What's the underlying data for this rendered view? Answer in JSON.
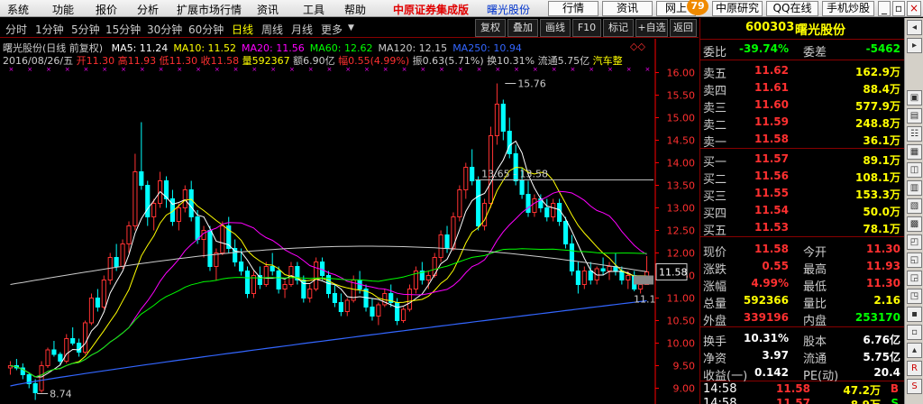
{
  "menu": {
    "items": [
      "系统",
      "功能",
      "报价",
      "分析",
      "扩展市场行情",
      "资讯",
      "工具",
      "帮助"
    ],
    "brand": "中原证券集成版",
    "brand_stock": "曙光股份",
    "right_buttons": [
      "行情",
      "资讯",
      "网上"
    ],
    "badge": "79",
    "right_buttons2": [
      "中原研究",
      "QQ在线",
      "手机炒股"
    ]
  },
  "toolbar": {
    "periods": [
      "分时",
      "1分钟",
      "5分钟",
      "15分钟",
      "30分钟",
      "60分钟",
      "日线",
      "周线",
      "月线",
      "更多"
    ],
    "active_period": "日线",
    "buttons": [
      "复权",
      "叠加",
      "画线",
      "F10",
      "标记",
      "+自选",
      "返回"
    ]
  },
  "chart_header": {
    "stock": "曙光股份(日线 前复权)",
    "ma": [
      {
        "label": "MA5: 11.24",
        "color": "#ffffff"
      },
      {
        "label": "MA10: 11.52",
        "color": "#ffff00"
      },
      {
        "label": "MA20: 11.56",
        "color": "#ff00ff"
      },
      {
        "label": "MA60: 12.62",
        "color": "#00ff00"
      },
      {
        "label": "MA120: 12.15",
        "color": "#cccccc"
      },
      {
        "label": "MA250: 10.94",
        "color": "#3366ff"
      }
    ],
    "info": {
      "date": "2016/08/26/五",
      "open": "开11.30",
      "high": "高11.93",
      "low": "低11.30",
      "close": "收11.58",
      "volume": "量592367",
      "amount": "额6.90亿",
      "change": "幅0.55(4.99%)",
      "amplitude": "振0.63(5.71%)",
      "turnover": "换10.31%",
      "float": "流通5.75亿",
      "sector": "汽车整"
    }
  },
  "chart_data": {
    "type": "candlestick",
    "y_ticks": [
      "16.00",
      "15.50",
      "15.00",
      "14.50",
      "14.00",
      "13.50",
      "13.00",
      "12.50",
      "12.00",
      "11.50",
      "11.00",
      "10.50",
      "10.00",
      "9.50",
      "9.00"
    ],
    "ylim": [
      8.75,
      16.15
    ],
    "annotations": [
      "15.76",
      "8.74",
      "13.65 - 13.58",
      "11.1"
    ],
    "current_price_label": "11.58",
    "candles": [
      [
        9.45,
        9.6,
        9.3,
        9.5
      ],
      [
        9.5,
        9.65,
        9.4,
        9.45
      ],
      [
        9.45,
        9.55,
        9.2,
        9.3
      ],
      [
        9.3,
        9.35,
        9.0,
        9.1
      ],
      [
        9.1,
        9.2,
        8.74,
        8.9
      ],
      [
        8.95,
        9.6,
        8.9,
        9.5
      ],
      [
        9.5,
        9.9,
        9.45,
        9.85
      ],
      [
        9.85,
        10.05,
        9.7,
        9.75
      ],
      [
        9.75,
        9.8,
        9.5,
        9.6
      ],
      [
        9.6,
        10.2,
        9.55,
        10.1
      ],
      [
        10.1,
        10.35,
        9.95,
        10.0
      ],
      [
        10.0,
        10.1,
        9.7,
        9.8
      ],
      [
        9.8,
        10.5,
        9.75,
        10.45
      ],
      [
        10.45,
        11.1,
        10.4,
        11.0
      ],
      [
        11.0,
        11.2,
        10.7,
        10.8
      ],
      [
        10.8,
        11.5,
        10.75,
        11.4
      ],
      [
        11.4,
        12.0,
        11.3,
        11.9
      ],
      [
        11.9,
        12.2,
        11.6,
        11.7
      ],
      [
        11.7,
        12.3,
        11.65,
        12.2
      ],
      [
        12.2,
        12.7,
        12.0,
        12.6
      ],
      [
        12.6,
        14.2,
        12.5,
        13.8
      ],
      [
        13.8,
        14.9,
        13.4,
        13.5
      ],
      [
        13.5,
        13.6,
        12.6,
        12.8
      ],
      [
        12.8,
        13.2,
        12.5,
        13.1
      ],
      [
        13.1,
        13.8,
        13.0,
        13.6
      ],
      [
        13.6,
        13.7,
        13.0,
        13.2
      ],
      [
        13.2,
        13.4,
        12.6,
        12.7
      ],
      [
        12.7,
        13.1,
        12.5,
        13.0
      ],
      [
        13.0,
        13.5,
        12.9,
        13.4
      ],
      [
        13.4,
        13.6,
        12.7,
        12.8
      ],
      [
        12.8,
        12.95,
        12.2,
        12.3
      ],
      [
        12.3,
        12.6,
        11.9,
        12.5
      ],
      [
        12.5,
        12.6,
        11.6,
        11.7
      ],
      [
        11.7,
        12.1,
        11.4,
        12.0
      ],
      [
        12.0,
        12.7,
        11.95,
        12.6
      ],
      [
        12.6,
        12.8,
        12.0,
        12.1
      ],
      [
        12.1,
        12.3,
        11.7,
        11.8
      ],
      [
        11.8,
        12.1,
        11.5,
        11.6
      ],
      [
        11.6,
        11.7,
        11.0,
        11.1
      ],
      [
        11.1,
        11.6,
        11.0,
        11.5
      ],
      [
        11.5,
        11.7,
        11.2,
        11.3
      ],
      [
        11.3,
        11.8,
        11.25,
        11.7
      ],
      [
        11.7,
        12.0,
        11.5,
        11.6
      ],
      [
        11.6,
        11.7,
        11.1,
        11.2
      ],
      [
        11.2,
        11.4,
        11.0,
        11.3
      ],
      [
        11.3,
        11.8,
        11.25,
        11.7
      ],
      [
        11.7,
        11.8,
        11.3,
        11.4
      ],
      [
        11.4,
        11.5,
        10.9,
        11.0
      ],
      [
        11.0,
        11.3,
        10.9,
        11.2
      ],
      [
        11.2,
        11.9,
        11.15,
        11.8
      ],
      [
        11.8,
        11.9,
        11.4,
        11.5
      ],
      [
        11.5,
        11.6,
        11.0,
        11.1
      ],
      [
        11.1,
        11.3,
        10.8,
        10.9
      ],
      [
        10.9,
        11.1,
        10.6,
        10.7
      ],
      [
        10.7,
        11.0,
        10.6,
        10.95
      ],
      [
        10.95,
        11.5,
        10.9,
        11.4
      ],
      [
        11.4,
        11.6,
        11.1,
        11.2
      ],
      [
        11.2,
        11.3,
        10.7,
        10.8
      ],
      [
        10.8,
        11.0,
        10.5,
        10.6
      ],
      [
        10.6,
        10.9,
        10.4,
        10.85
      ],
      [
        10.85,
        11.2,
        10.8,
        11.1
      ],
      [
        11.1,
        11.3,
        10.8,
        10.9
      ],
      [
        10.9,
        11.0,
        10.4,
        10.5
      ],
      [
        10.5,
        10.8,
        10.45,
        10.75
      ],
      [
        10.75,
        11.3,
        10.7,
        11.2
      ],
      [
        11.2,
        11.7,
        11.1,
        11.6
      ],
      [
        11.6,
        11.8,
        11.3,
        11.4
      ],
      [
        11.4,
        11.6,
        11.2,
        11.5
      ],
      [
        11.5,
        12.0,
        11.45,
        11.9
      ],
      [
        11.9,
        12.5,
        11.8,
        12.4
      ],
      [
        12.4,
        12.6,
        12.0,
        12.1
      ],
      [
        12.1,
        12.9,
        12.05,
        12.8
      ],
      [
        12.8,
        13.5,
        12.7,
        13.4
      ],
      [
        13.4,
        14.0,
        13.2,
        13.9
      ],
      [
        13.9,
        14.3,
        13.5,
        13.6
      ],
      [
        13.6,
        13.7,
        12.5,
        12.6
      ],
      [
        12.6,
        13.2,
        12.5,
        13.1
      ],
      [
        13.1,
        14.8,
        13.0,
        14.6
      ],
      [
        14.6,
        15.76,
        14.4,
        15.3
      ],
      [
        15.3,
        15.4,
        14.5,
        14.7
      ],
      [
        14.7,
        15.0,
        14.1,
        14.2
      ],
      [
        14.2,
        14.4,
        13.5,
        13.6
      ],
      [
        13.6,
        13.9,
        13.2,
        13.3
      ],
      [
        13.3,
        13.6,
        12.8,
        12.9
      ],
      [
        12.9,
        13.3,
        12.8,
        13.2
      ],
      [
        13.2,
        13.3,
        12.9,
        13.0
      ],
      [
        13.0,
        13.2,
        12.7,
        12.8
      ],
      [
        12.8,
        13.2,
        12.7,
        13.1
      ],
      [
        13.1,
        13.2,
        12.6,
        12.7
      ],
      [
        12.7,
        12.8,
        12.1,
        12.2
      ],
      [
        12.2,
        12.4,
        11.5,
        11.6
      ],
      [
        11.6,
        11.8,
        11.1,
        11.3
      ],
      [
        11.3,
        11.7,
        11.2,
        11.6
      ],
      [
        11.6,
        11.8,
        11.3,
        11.4
      ],
      [
        11.4,
        11.7,
        11.3,
        11.65
      ],
      [
        11.65,
        11.9,
        11.5,
        11.6
      ],
      [
        11.6,
        11.8,
        11.4,
        11.7
      ],
      [
        11.7,
        12.0,
        11.5,
        11.6
      ],
      [
        11.6,
        11.7,
        11.3,
        11.4
      ],
      [
        11.4,
        11.6,
        11.2,
        11.5
      ],
      [
        11.5,
        11.6,
        11.15,
        11.2
      ],
      [
        11.2,
        11.4,
        11.1,
        11.3
      ],
      [
        11.3,
        11.93,
        11.3,
        11.58
      ]
    ]
  },
  "quote": {
    "code": "600303",
    "name": "曙光股份",
    "weibi": {
      "label": "委比",
      "value": "-39.74%",
      "label2": "委差",
      "value2": "-5462"
    },
    "asks": [
      {
        "label": "卖五",
        "price": "11.62",
        "vol": "162.9万"
      },
      {
        "label": "卖四",
        "price": "11.61",
        "vol": "88.4万"
      },
      {
        "label": "卖三",
        "price": "11.60",
        "vol": "577.9万"
      },
      {
        "label": "卖二",
        "price": "11.59",
        "vol": "248.8万"
      },
      {
        "label": "卖一",
        "price": "11.58",
        "vol": "36.1万"
      }
    ],
    "bids": [
      {
        "label": "买一",
        "price": "11.57",
        "vol": "89.1万"
      },
      {
        "label": "买二",
        "price": "11.56",
        "vol": "108.1万"
      },
      {
        "label": "买三",
        "price": "11.55",
        "vol": "153.3万"
      },
      {
        "label": "买四",
        "price": "11.54",
        "vol": "50.0万"
      },
      {
        "label": "买五",
        "price": "11.53",
        "vol": "78.1万"
      }
    ],
    "stats": [
      {
        "k1": "现价",
        "v1": "11.58",
        "c1": "#ff3030",
        "k2": "今开",
        "v2": "11.30",
        "c2": "#ff3030"
      },
      {
        "k1": "涨跌",
        "v1": "0.55",
        "c1": "#ff3030",
        "k2": "最高",
        "v2": "11.93",
        "c2": "#ff3030"
      },
      {
        "k1": "涨幅",
        "v1": "4.99%",
        "c1": "#ff3030",
        "k2": "最低",
        "v2": "11.30",
        "c2": "#ff3030"
      },
      {
        "k1": "总量",
        "v1": "592366",
        "c1": "#ffff00",
        "k2": "量比",
        "v2": "2.16",
        "c2": "#ffff00"
      },
      {
        "k1": "外盘",
        "v1": "339196",
        "c1": "#ff3030",
        "k2": "内盘",
        "v2": "253170",
        "c2": "#00ff00"
      }
    ],
    "stats2": [
      {
        "k1": "换手",
        "v1": "10.31%",
        "k2": "股本",
        "v2": "6.76亿"
      },
      {
        "k1": "净资",
        "v1": "3.97",
        "k2": "流通",
        "v2": "5.75亿"
      },
      {
        "k1": "收益(一)",
        "v1": "0.142",
        "k2": "PE(动)",
        "v2": "20.4"
      }
    ],
    "ticks": [
      {
        "time": "14:58",
        "price": "11.58",
        "vol": "47.2万",
        "side": "B"
      },
      {
        "time": "14:58",
        "price": "11.57",
        "vol": "8.9万",
        "side": "S"
      }
    ]
  },
  "colors": {
    "up": "#ff3232",
    "down": "#00ffff",
    "grid": "#800000",
    "axis": "#ff0000"
  }
}
